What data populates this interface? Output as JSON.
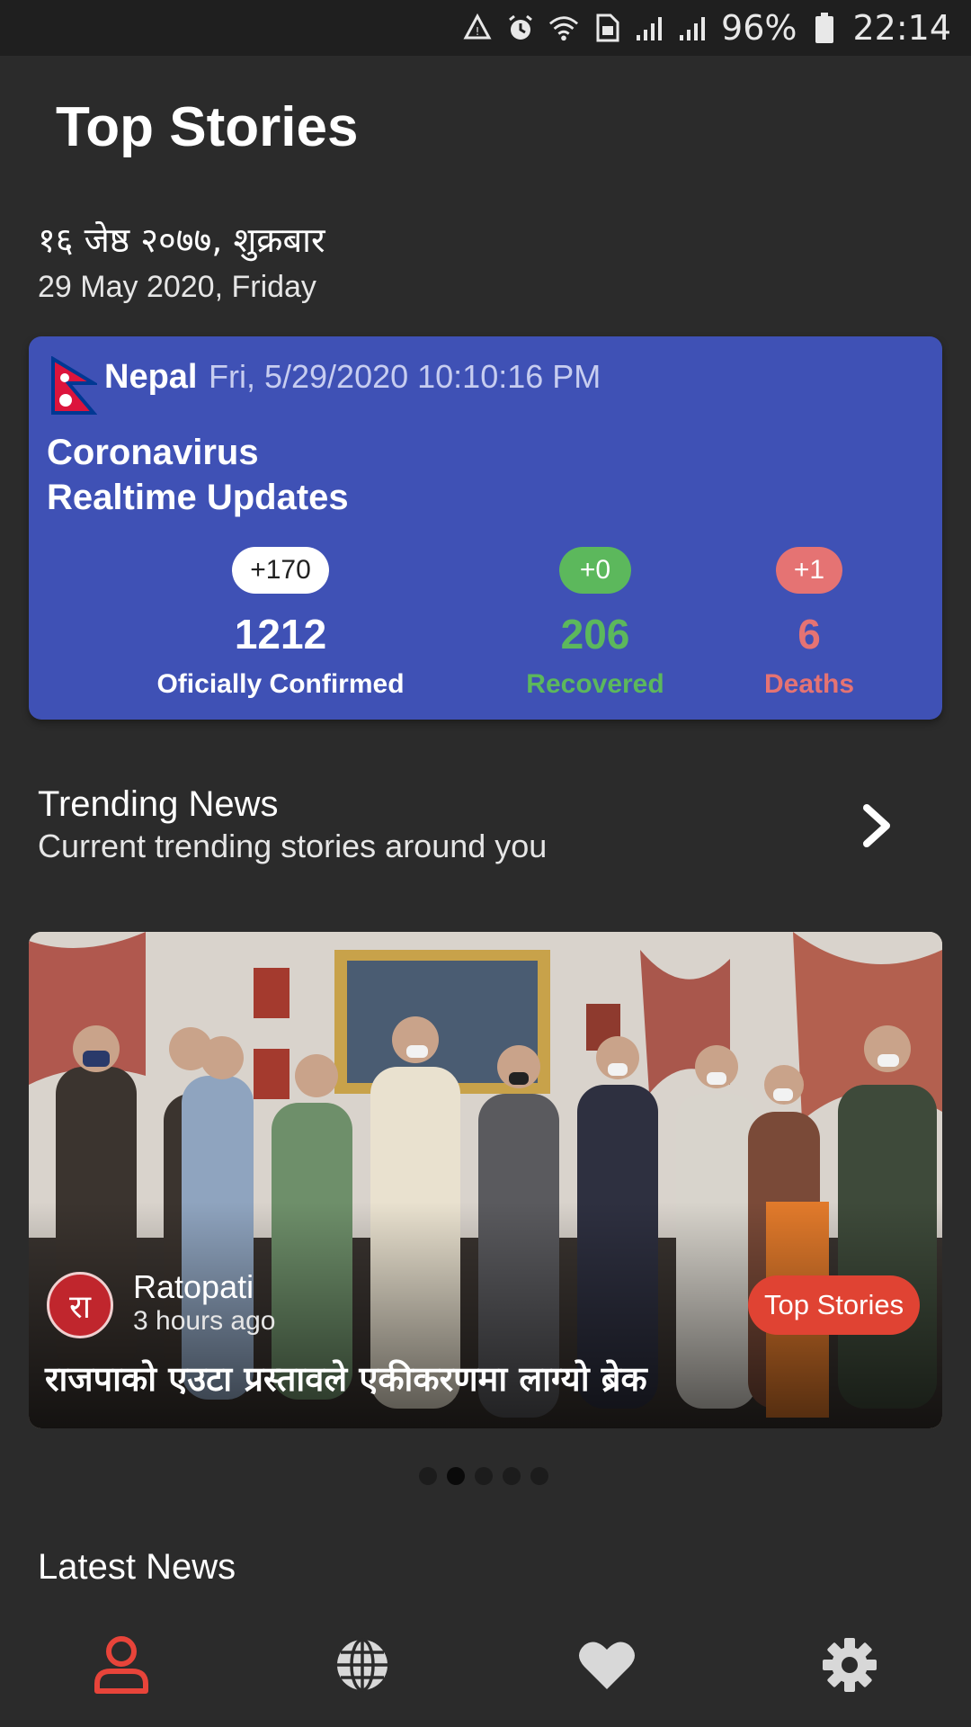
{
  "status_bar": {
    "battery": "96%",
    "time": "22:14",
    "icons": [
      "data-saver-icon",
      "alarm-icon",
      "wifi-icon",
      "sim-icon",
      "signal-icon",
      "signal-icon",
      "battery-icon"
    ]
  },
  "header": {
    "title": "Top Stories",
    "date_nepali": "१६ जेष्ठ २०७७, शुक्रबार",
    "date_english": "29 May 2020, Friday"
  },
  "covid": {
    "country": "Nepal",
    "timestamp": "Fri, 5/29/2020 10:10:16 PM",
    "title_line1": "Coronavirus",
    "title_line2": "Realtime Updates",
    "confirmed": {
      "delta": "+170",
      "value": "1212",
      "label": "Oficially Confirmed"
    },
    "recovered": {
      "delta": "+0",
      "value": "206",
      "label": "Recovered"
    },
    "deaths": {
      "delta": "+1",
      "value": "6",
      "label": "Deaths"
    },
    "colors": {
      "card": "#3f51b5",
      "recovered": "#5cb85c",
      "deaths": "#e57373"
    }
  },
  "trending": {
    "title": "Trending News",
    "subtitle": "Current trending stories around you"
  },
  "featured_story": {
    "source_logo": "रा",
    "source": "Ratopati",
    "time": "3 hours ago",
    "tag": "Top Stories",
    "headline": "राजपाको एउटा प्रस्तावले एकीकरणमा लाग्यो ब्रेक"
  },
  "carousel": {
    "count": 5,
    "active_index": 1
  },
  "latest": {
    "title": "Latest News"
  },
  "bottom_nav": {
    "items": [
      "profile-icon",
      "globe-icon",
      "heart-icon",
      "settings-icon"
    ],
    "active_index": 0,
    "active_color": "#e8443a",
    "inactive_color": "#d8d8d8"
  }
}
